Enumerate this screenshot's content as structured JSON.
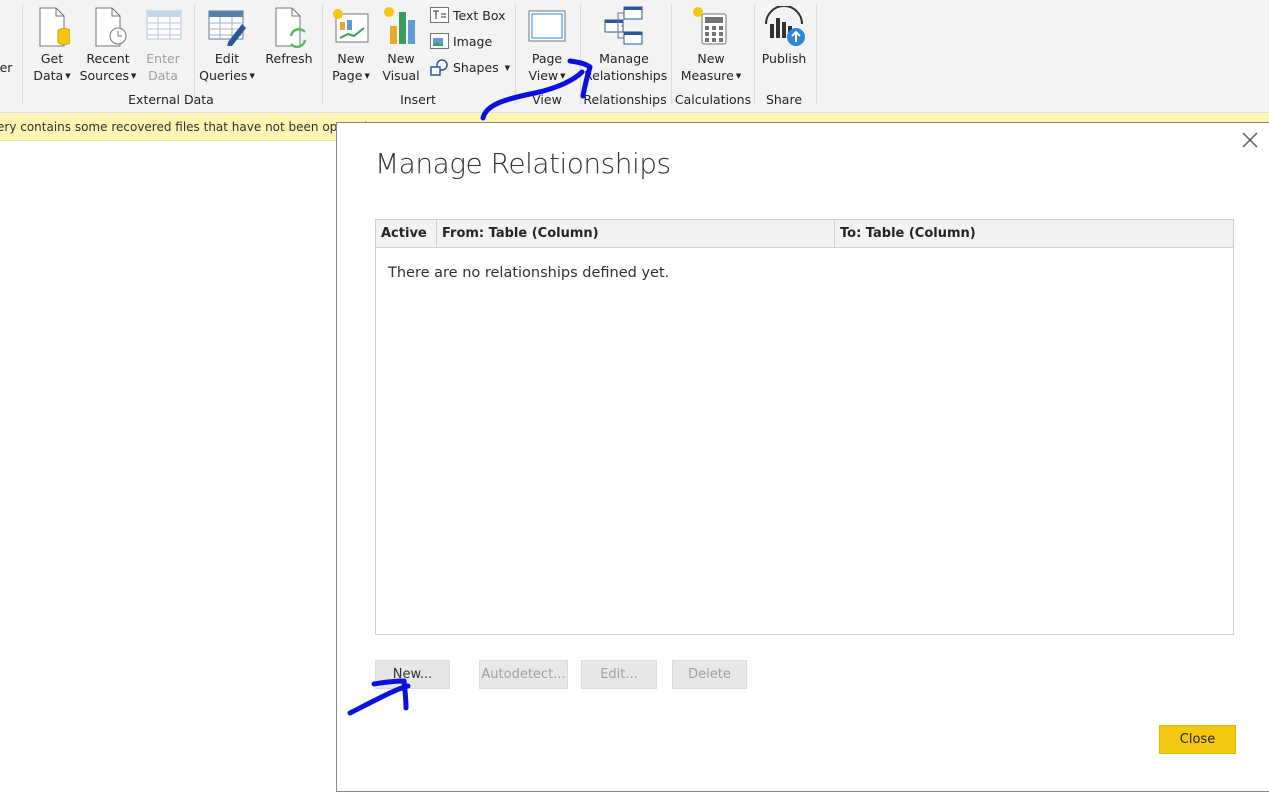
{
  "ribbon": {
    "cut_label": "er",
    "external_data": {
      "group_label": "External Data",
      "get_data": {
        "line1": "Get",
        "line2": "Data"
      },
      "recent_sources": {
        "line1": "Recent",
        "line2": "Sources"
      },
      "enter_data": {
        "line1": "Enter",
        "line2": "Data"
      },
      "edit_queries": {
        "line1": "Edit",
        "line2": "Queries"
      },
      "refresh": {
        "line1": "Refresh"
      }
    },
    "insert": {
      "group_label": "Insert",
      "new_page": {
        "line1": "New",
        "line2": "Page"
      },
      "new_visual": {
        "line1": "New",
        "line2": "Visual"
      },
      "text_box": "Text Box",
      "image": "Image",
      "shapes": "Shapes"
    },
    "view": {
      "group_label": "View",
      "page_view": {
        "line1": "Page",
        "line2": "View"
      }
    },
    "relationships": {
      "group_label": "Relationships",
      "manage_relationships": {
        "line1": "Manage",
        "line2": "Relationships"
      }
    },
    "calculations": {
      "group_label": "Calculations",
      "new_measure": {
        "line1": "New",
        "line2": "Measure"
      }
    },
    "share": {
      "group_label": "Share",
      "publish": {
        "line1": "Publish"
      }
    }
  },
  "infobar": {
    "message": "ery contains some recovered files that have not been opened"
  },
  "dialog": {
    "title": "Manage Relationships",
    "columns": [
      "Active",
      "From: Table (Column)",
      "To: Table (Column)"
    ],
    "empty_message": "There are no relationships defined yet.",
    "buttons": {
      "new": "New...",
      "autodetect": "Autodetect...",
      "edit": "Edit...",
      "delete": "Delete",
      "close": "Close"
    }
  },
  "colors": {
    "accent_yellow": "#f2c811",
    "infobar_bg": "#fdf5b2",
    "annotation_blue": "#0a10e0"
  }
}
